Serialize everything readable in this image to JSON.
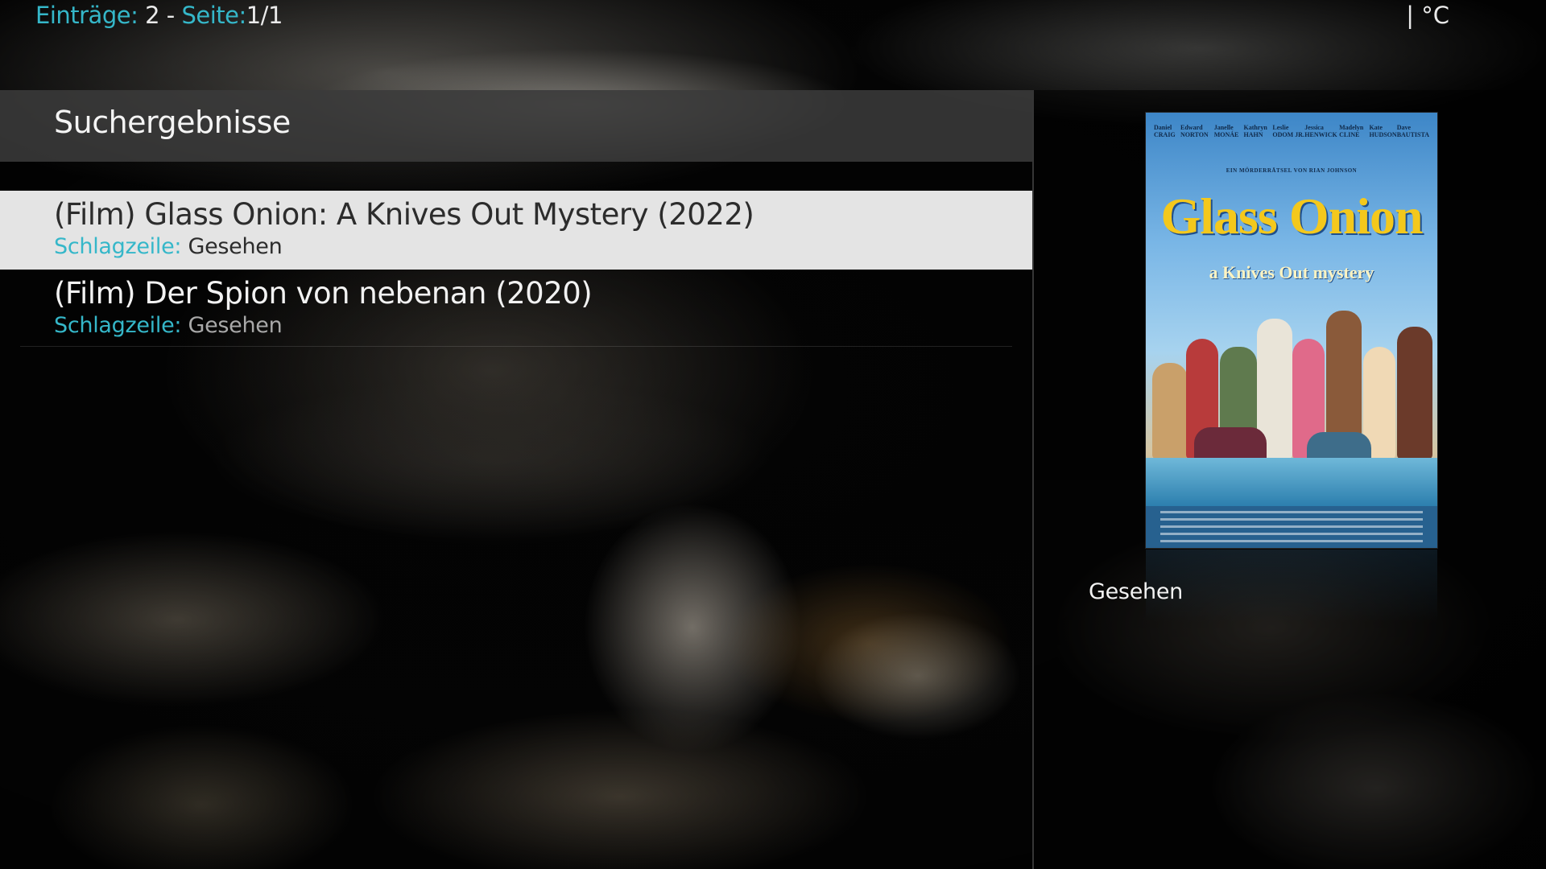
{
  "header": {
    "entries_label": "Einträge:",
    "entries_value": "2",
    "separator": "-",
    "page_label": "Seite:",
    "page_value": "1/1",
    "temperature": "| °C"
  },
  "page_title": "Suchergebnisse",
  "results": [
    {
      "title": "(Film) Glass Onion: A Knives Out Mystery (2022)",
      "subtitle_label": "Schlagzeile:",
      "subtitle_value": "Gesehen",
      "selected": true
    },
    {
      "title": "(Film) Der Spion von nebenan (2020)",
      "subtitle_label": "Schlagzeile:",
      "subtitle_value": "Gesehen",
      "selected": false
    }
  ],
  "detail": {
    "poster": {
      "cast": [
        "Daniel CRAIG",
        "Edward NORTON",
        "Janelle MONÁE",
        "Kathryn HAHN",
        "Leslie ODOM JR.",
        "Jessica HENWICK",
        "Madelyn CLINE",
        "Kate HUDSON",
        "Dave BAUTISTA"
      ],
      "tagline": "EIN MÖRDERRÄTSEL VON RIAN JOHNSON",
      "title": "Glass Onion",
      "subtitle": "a Knives Out mystery"
    },
    "status": "Gesehen"
  },
  "colors": {
    "accent": "#35b7c9",
    "selected_row": "#e4e4e4",
    "title_bar": "#3a3a3a"
  }
}
